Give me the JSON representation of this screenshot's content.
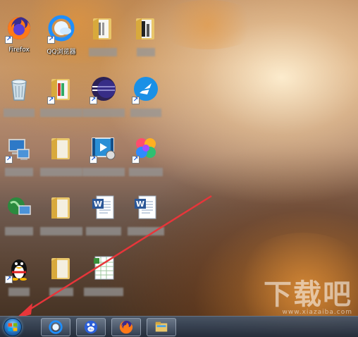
{
  "desktop": {
    "icons": [
      {
        "id": "firefox",
        "label": "Firefox",
        "icon": "firefox-icon"
      },
      {
        "id": "qq-browser",
        "label": "QQ浏览器",
        "icon": "qq-browser-icon"
      },
      {
        "id": "folder-1",
        "label": "",
        "icon": "folder-icon"
      },
      {
        "id": "folder-2",
        "label": "",
        "icon": "folder-icon"
      },
      {
        "id": "recycle-bin",
        "label": "",
        "icon": "recycle-bin-icon"
      },
      {
        "id": "folder-3",
        "label": "",
        "icon": "folder-icon"
      },
      {
        "id": "eclipse",
        "label": "",
        "icon": "eclipse-icon"
      },
      {
        "id": "feishu",
        "label": "",
        "icon": "feishu-icon"
      },
      {
        "id": "computer",
        "label": "",
        "icon": "computer-icon"
      },
      {
        "id": "folder-4",
        "label": "",
        "icon": "folder-icon"
      },
      {
        "id": "video-player",
        "label": "",
        "icon": "video-player-icon"
      },
      {
        "id": "photos",
        "label": "",
        "icon": "photos-icon"
      },
      {
        "id": "network",
        "label": "",
        "icon": "network-icon"
      },
      {
        "id": "folder-5",
        "label": "",
        "icon": "folder-icon"
      },
      {
        "id": "word-doc-1",
        "label": "",
        "icon": "word-document-icon"
      },
      {
        "id": "word-doc-2",
        "label": "",
        "icon": "word-document-icon"
      },
      {
        "id": "qq",
        "label": "",
        "icon": "qq-penguin-icon"
      },
      {
        "id": "folder-6",
        "label": "",
        "icon": "folder-icon"
      },
      {
        "id": "spreadsheet",
        "label": "",
        "icon": "spreadsheet-icon"
      }
    ]
  },
  "taskbar": {
    "start": {
      "icon": "windows-start-orb-icon"
    },
    "pinned": [
      {
        "id": "qq-browser",
        "icon": "qq-browser-icon"
      },
      {
        "id": "baidu",
        "icon": "baidu-paw-icon",
        "text": "du"
      },
      {
        "id": "firefox",
        "icon": "firefox-icon"
      },
      {
        "id": "explorer",
        "icon": "file-explorer-icon"
      }
    ]
  },
  "watermark": {
    "big": "下载吧",
    "small": "www.xiazaiba.com"
  },
  "colors": {
    "annotation_arrow": "#e8353a",
    "taskbar": "#2f3b4c"
  }
}
